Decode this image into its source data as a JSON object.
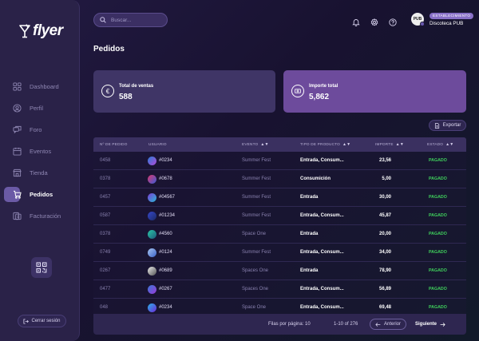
{
  "brand": {
    "name": "flyer"
  },
  "sidebar": {
    "items": [
      {
        "label": "Dashboard",
        "icon": "dashboard-icon",
        "active": false
      },
      {
        "label": "Perfil",
        "icon": "profile-icon",
        "active": false
      },
      {
        "label": "Foro",
        "icon": "forum-icon",
        "active": false
      },
      {
        "label": "Eventos",
        "icon": "calendar-icon",
        "active": false
      },
      {
        "label": "Tienda",
        "icon": "store-icon",
        "active": false
      },
      {
        "label": "Pedidos",
        "icon": "cart-icon",
        "active": true
      },
      {
        "label": "Facturación",
        "icon": "invoice-icon",
        "active": false
      }
    ],
    "qr_icon": "qr-code-icon",
    "logout_label": "Cerrar sesión"
  },
  "search": {
    "placeholder": "Buscar..."
  },
  "user": {
    "role": "ESTABLECIMIENTO",
    "name": "Discoteca PUB",
    "avatar_text": "PUB"
  },
  "page": {
    "title": "Pedidos"
  },
  "cards": [
    {
      "label": "Total de ventas",
      "value": "588",
      "icon": "euro-icon"
    },
    {
      "label": "Importe total",
      "value": "5,862",
      "icon": "money-icon"
    }
  ],
  "export_label": "Exportar",
  "table": {
    "headers": [
      "Nº DE PEDIDO",
      "USUARIO",
      "EVENTO",
      "TIPO DE PRODUCTO",
      "IMPORTE",
      "ESTADO"
    ],
    "rows": [
      {
        "id": "0458",
        "user": "#0234",
        "event": "Summer Fest",
        "type": "Entrada, Consum...",
        "amount": "23,56",
        "status": "PAGADO"
      },
      {
        "id": "0378",
        "user": "#0678",
        "event": "Summer Fest",
        "type": "Consumición",
        "amount": "5,00",
        "status": "PAGADO"
      },
      {
        "id": "0457",
        "user": "#04567",
        "event": "Summer Fest",
        "type": "Entrada",
        "amount": "30,00",
        "status": "PAGADO"
      },
      {
        "id": "0587",
        "user": "#01234",
        "event": "Summer Fest",
        "type": "Entrada, Consum...",
        "amount": "45,87",
        "status": "PAGADO"
      },
      {
        "id": "0378",
        "user": "#4560",
        "event": "Space One",
        "type": "Entrada",
        "amount": "20,00",
        "status": "PAGADO"
      },
      {
        "id": "0749",
        "user": "#0124",
        "event": "Summer Fest",
        "type": "Entrada, Consum...",
        "amount": "34,00",
        "status": "PAGADO"
      },
      {
        "id": "0267",
        "user": "#0689",
        "event": "Spaces One",
        "type": "Entrada",
        "amount": "78,90",
        "status": "PAGADO"
      },
      {
        "id": "0477",
        "user": "#0267",
        "event": "Spaces One",
        "type": "Entrada, Consum...",
        "amount": "56,89",
        "status": "PAGADO"
      },
      {
        "id": "048",
        "user": "#0234",
        "event": "Space One",
        "type": "Entrada, Consum...",
        "amount": "69,48",
        "status": "PAGADO"
      }
    ]
  },
  "pagination": {
    "rows_per_page": "Filas por página: 10",
    "range": "1-10 of 276",
    "prev_label": "Anterior",
    "next_label": "Siguiente"
  },
  "colors": {
    "background": "#1b1534",
    "sidebar": "#2a2248",
    "accent": "#6b5aa6",
    "status_paid": "#3fcf5c",
    "card_sales": "#3f3566",
    "card_amount": "#6d4b9c"
  }
}
